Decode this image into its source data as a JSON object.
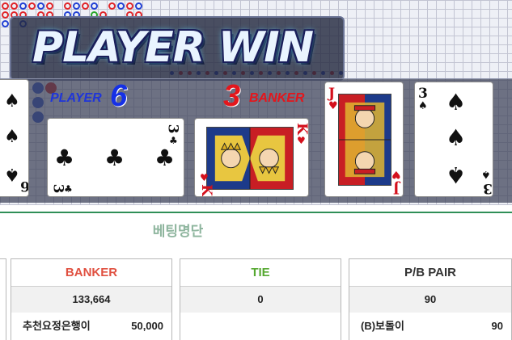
{
  "banner": {
    "result_text": "PLAYER WIN"
  },
  "player": {
    "label": "PLAYER",
    "score": "6"
  },
  "banker": {
    "label": "BANKER",
    "score": "3"
  },
  "cards": {
    "player": [
      {
        "rank": "6",
        "suit": "♠",
        "color": "black"
      },
      {
        "rank": "3",
        "suit": "♣",
        "color": "black"
      }
    ],
    "banker": [
      {
        "rank": "K",
        "suit": "♥",
        "color": "red"
      },
      {
        "rank": "J",
        "suit": "♥",
        "color": "red"
      },
      {
        "rank": "3",
        "suit": "♠",
        "color": "black"
      }
    ]
  },
  "betting": {
    "title": "베팅명단",
    "columns": [
      {
        "header": "BANKER",
        "header_color": "#e05040",
        "total": "133,664",
        "rows": [
          {
            "name": "추천요정은행이",
            "amount": "50,000"
          }
        ]
      },
      {
        "header": "TIE",
        "header_color": "#55a830",
        "total": "0",
        "rows": []
      },
      {
        "header": "P/B PAIR",
        "header_color": "#333333",
        "total": "90",
        "rows": [
          {
            "name": "(B)보돌이",
            "amount": "90"
          }
        ]
      }
    ]
  },
  "colors": {
    "player_blue": "#1530e6",
    "banker_red": "#e4161c",
    "accent_green": "#2f8f58"
  }
}
